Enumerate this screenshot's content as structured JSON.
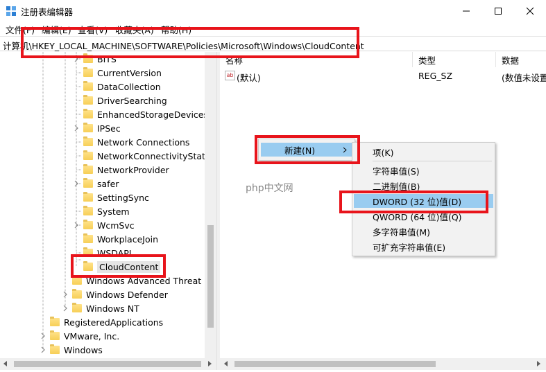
{
  "window": {
    "title": "注册表编辑器"
  },
  "menubar": [
    "文件(F)",
    "编辑(E)",
    "查看(V)",
    "收藏夹(A)",
    "帮助(H)"
  ],
  "address": "计算机\\HKEY_LOCAL_MACHINE\\SOFTWARE\\Policies\\Microsoft\\Windows\\CloudContent",
  "tree": [
    {
      "label": "BITS"
    },
    {
      "label": "CurrentVersion"
    },
    {
      "label": "DataCollection"
    },
    {
      "label": "DriverSearching"
    },
    {
      "label": "EnhancedStorageDevices"
    },
    {
      "label": "IPSec"
    },
    {
      "label": "Network Connections"
    },
    {
      "label": "NetworkConnectivityStatus"
    },
    {
      "label": "NetworkProvider"
    },
    {
      "label": "safer"
    },
    {
      "label": "SettingSync"
    },
    {
      "label": "System"
    },
    {
      "label": "WcmSvc"
    },
    {
      "label": "WorkplaceJoin"
    },
    {
      "label": "WSDAPI"
    },
    {
      "label": "CloudContent"
    },
    {
      "label": "Windows Advanced Threat Pr"
    },
    {
      "label": "Windows Defender"
    },
    {
      "label": "Windows NT"
    },
    {
      "label": "RegisteredApplications"
    },
    {
      "label": "VMware, Inc."
    },
    {
      "label": "Windows"
    }
  ],
  "columns": {
    "name": "名称",
    "type": "类型",
    "data": "数据"
  },
  "values": [
    {
      "name": "(默认)",
      "type": "REG_SZ",
      "data": "(数值未设置"
    }
  ],
  "context_menu": {
    "new": "新建(N)"
  },
  "submenu": [
    "项(K)",
    "字符串值(S)",
    "二进制值(B)",
    "DWORD (32 位)值(D)",
    "QWORD (64 位)值(Q)",
    "多字符串值(M)",
    "可扩充字符串值(E)"
  ],
  "watermark": "php中文网",
  "colors": {
    "highlight": "#99ccf0",
    "annotation": "#e8141b",
    "folder": "#f7cf57"
  }
}
